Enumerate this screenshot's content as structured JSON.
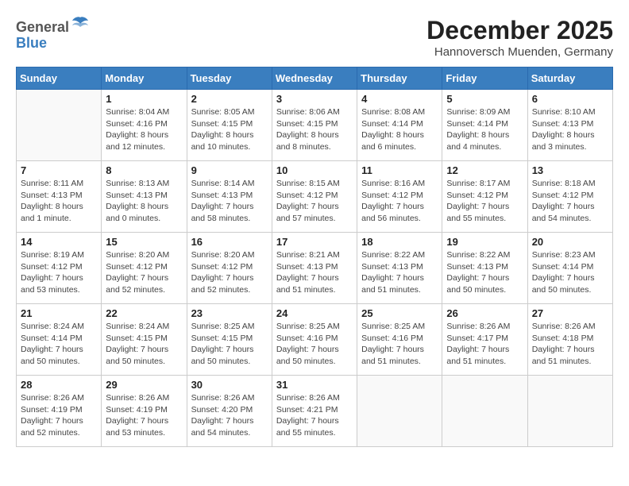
{
  "header": {
    "logo_line1": "General",
    "logo_line2": "Blue",
    "month_title": "December 2025",
    "location": "Hannoversch Muenden, Germany"
  },
  "calendar": {
    "days_of_week": [
      "Sunday",
      "Monday",
      "Tuesday",
      "Wednesday",
      "Thursday",
      "Friday",
      "Saturday"
    ],
    "weeks": [
      [
        {
          "day": "",
          "info": ""
        },
        {
          "day": "1",
          "info": "Sunrise: 8:04 AM\nSunset: 4:16 PM\nDaylight: 8 hours\nand 12 minutes."
        },
        {
          "day": "2",
          "info": "Sunrise: 8:05 AM\nSunset: 4:15 PM\nDaylight: 8 hours\nand 10 minutes."
        },
        {
          "day": "3",
          "info": "Sunrise: 8:06 AM\nSunset: 4:15 PM\nDaylight: 8 hours\nand 8 minutes."
        },
        {
          "day": "4",
          "info": "Sunrise: 8:08 AM\nSunset: 4:14 PM\nDaylight: 8 hours\nand 6 minutes."
        },
        {
          "day": "5",
          "info": "Sunrise: 8:09 AM\nSunset: 4:14 PM\nDaylight: 8 hours\nand 4 minutes."
        },
        {
          "day": "6",
          "info": "Sunrise: 8:10 AM\nSunset: 4:13 PM\nDaylight: 8 hours\nand 3 minutes."
        }
      ],
      [
        {
          "day": "7",
          "info": "Sunrise: 8:11 AM\nSunset: 4:13 PM\nDaylight: 8 hours\nand 1 minute."
        },
        {
          "day": "8",
          "info": "Sunrise: 8:13 AM\nSunset: 4:13 PM\nDaylight: 8 hours\nand 0 minutes."
        },
        {
          "day": "9",
          "info": "Sunrise: 8:14 AM\nSunset: 4:13 PM\nDaylight: 7 hours\nand 58 minutes."
        },
        {
          "day": "10",
          "info": "Sunrise: 8:15 AM\nSunset: 4:12 PM\nDaylight: 7 hours\nand 57 minutes."
        },
        {
          "day": "11",
          "info": "Sunrise: 8:16 AM\nSunset: 4:12 PM\nDaylight: 7 hours\nand 56 minutes."
        },
        {
          "day": "12",
          "info": "Sunrise: 8:17 AM\nSunset: 4:12 PM\nDaylight: 7 hours\nand 55 minutes."
        },
        {
          "day": "13",
          "info": "Sunrise: 8:18 AM\nSunset: 4:12 PM\nDaylight: 7 hours\nand 54 minutes."
        }
      ],
      [
        {
          "day": "14",
          "info": "Sunrise: 8:19 AM\nSunset: 4:12 PM\nDaylight: 7 hours\nand 53 minutes."
        },
        {
          "day": "15",
          "info": "Sunrise: 8:20 AM\nSunset: 4:12 PM\nDaylight: 7 hours\nand 52 minutes."
        },
        {
          "day": "16",
          "info": "Sunrise: 8:20 AM\nSunset: 4:12 PM\nDaylight: 7 hours\nand 52 minutes."
        },
        {
          "day": "17",
          "info": "Sunrise: 8:21 AM\nSunset: 4:13 PM\nDaylight: 7 hours\nand 51 minutes."
        },
        {
          "day": "18",
          "info": "Sunrise: 8:22 AM\nSunset: 4:13 PM\nDaylight: 7 hours\nand 51 minutes."
        },
        {
          "day": "19",
          "info": "Sunrise: 8:22 AM\nSunset: 4:13 PM\nDaylight: 7 hours\nand 50 minutes."
        },
        {
          "day": "20",
          "info": "Sunrise: 8:23 AM\nSunset: 4:14 PM\nDaylight: 7 hours\nand 50 minutes."
        }
      ],
      [
        {
          "day": "21",
          "info": "Sunrise: 8:24 AM\nSunset: 4:14 PM\nDaylight: 7 hours\nand 50 minutes."
        },
        {
          "day": "22",
          "info": "Sunrise: 8:24 AM\nSunset: 4:15 PM\nDaylight: 7 hours\nand 50 minutes."
        },
        {
          "day": "23",
          "info": "Sunrise: 8:25 AM\nSunset: 4:15 PM\nDaylight: 7 hours\nand 50 minutes."
        },
        {
          "day": "24",
          "info": "Sunrise: 8:25 AM\nSunset: 4:16 PM\nDaylight: 7 hours\nand 50 minutes."
        },
        {
          "day": "25",
          "info": "Sunrise: 8:25 AM\nSunset: 4:16 PM\nDaylight: 7 hours\nand 51 minutes."
        },
        {
          "day": "26",
          "info": "Sunrise: 8:26 AM\nSunset: 4:17 PM\nDaylight: 7 hours\nand 51 minutes."
        },
        {
          "day": "27",
          "info": "Sunrise: 8:26 AM\nSunset: 4:18 PM\nDaylight: 7 hours\nand 51 minutes."
        }
      ],
      [
        {
          "day": "28",
          "info": "Sunrise: 8:26 AM\nSunset: 4:19 PM\nDaylight: 7 hours\nand 52 minutes."
        },
        {
          "day": "29",
          "info": "Sunrise: 8:26 AM\nSunset: 4:19 PM\nDaylight: 7 hours\nand 53 minutes."
        },
        {
          "day": "30",
          "info": "Sunrise: 8:26 AM\nSunset: 4:20 PM\nDaylight: 7 hours\nand 54 minutes."
        },
        {
          "day": "31",
          "info": "Sunrise: 8:26 AM\nSunset: 4:21 PM\nDaylight: 7 hours\nand 55 minutes."
        },
        {
          "day": "",
          "info": ""
        },
        {
          "day": "",
          "info": ""
        },
        {
          "day": "",
          "info": ""
        }
      ]
    ]
  }
}
